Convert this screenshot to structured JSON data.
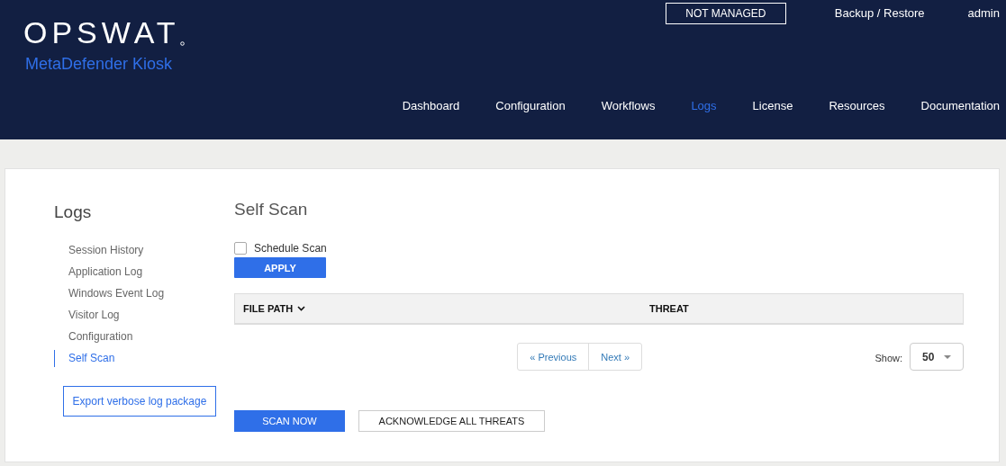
{
  "header": {
    "logo": "OPSWAT",
    "product": "MetaDefender Kiosk",
    "status_badge": "NOT MANAGED",
    "top_links": [
      "Backup / Restore",
      "admin"
    ],
    "nav": [
      {
        "label": "Dashboard",
        "selected": false
      },
      {
        "label": "Configuration",
        "selected": false
      },
      {
        "label": "Workflows",
        "selected": false
      },
      {
        "label": "Logs",
        "selected": true
      },
      {
        "label": "License",
        "selected": false
      },
      {
        "label": "Resources",
        "selected": false
      },
      {
        "label": "Documentation",
        "selected": false
      }
    ]
  },
  "sidebar": {
    "title": "Logs",
    "items": [
      {
        "label": "Session History",
        "selected": false
      },
      {
        "label": "Application Log",
        "selected": false
      },
      {
        "label": "Windows Event Log",
        "selected": false
      },
      {
        "label": "Visitor Log",
        "selected": false
      },
      {
        "label": "Configuration",
        "selected": false
      },
      {
        "label": "Self Scan",
        "selected": true
      }
    ],
    "export_button": "Export verbose log package"
  },
  "main": {
    "title": "Self Scan",
    "schedule": {
      "label": "Schedule Scan",
      "checked": false
    },
    "apply_button": "APPLY",
    "table": {
      "columns": [
        {
          "label": "FILE PATH",
          "sortable": true
        },
        {
          "label": "THREAT",
          "sortable": false
        }
      ]
    },
    "pagination": {
      "previous": "« Previous",
      "next": "Next »"
    },
    "show": {
      "label": "Show:",
      "value": "50"
    },
    "buttons": [
      {
        "label": "SCAN NOW",
        "kind": "primary"
      },
      {
        "label": "ACKNOWLEDGE ALL THREATS",
        "kind": "outline"
      }
    ]
  }
}
